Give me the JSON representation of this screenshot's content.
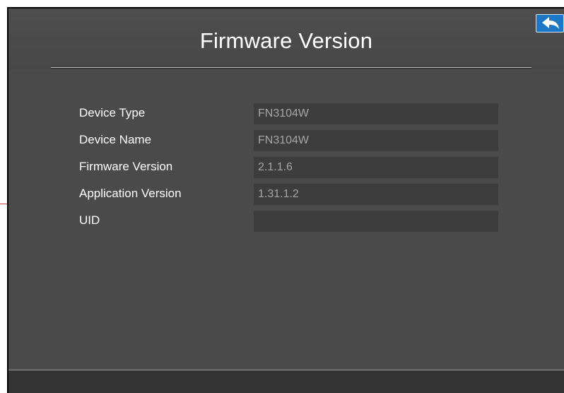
{
  "header": {
    "title": "Firmware Version",
    "back_icon": "back-arrow-icon"
  },
  "device_info": {
    "rows": [
      {
        "label": "Device Type",
        "value": "FN3104W"
      },
      {
        "label": "Device Name",
        "value": "FN3104W"
      },
      {
        "label": "Firmware Version",
        "value": "2.1.1.6"
      },
      {
        "label": "Application Version",
        "value": "1.31.1.2"
      },
      {
        "label": "UID",
        "value": ""
      }
    ]
  },
  "colors": {
    "panel_background": "#4a4a4a",
    "field_background": "#3d3d3d",
    "field_text": "#a6a6a6",
    "label_text": "#ffffff",
    "back_button": "#1c78c7"
  }
}
